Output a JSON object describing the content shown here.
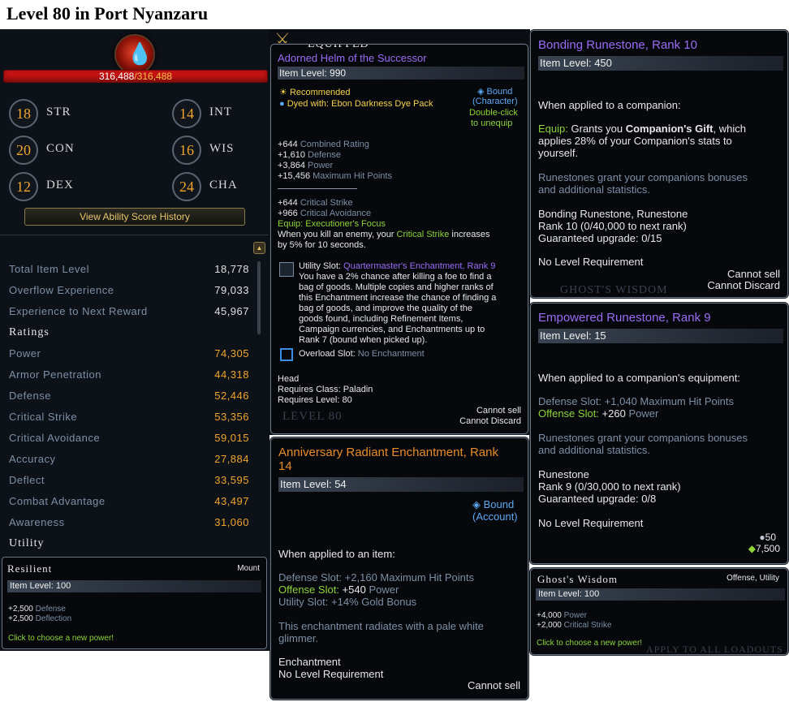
{
  "page_title": "Level 80 in Port Nyanzaru",
  "character": {
    "hp_current": "316,488",
    "hp_sep": "/",
    "hp_max": "316,488",
    "abilities": [
      {
        "score": "18",
        "name": "STR"
      },
      {
        "score": "14",
        "name": "INT"
      },
      {
        "score": "20",
        "name": "CON"
      },
      {
        "score": "16",
        "name": "WIS"
      },
      {
        "score": "12",
        "name": "DEX"
      },
      {
        "score": "24",
        "name": "CHA"
      }
    ],
    "history_button": "View Ability Score History",
    "general": [
      {
        "label": "Total Item Level",
        "value": "18,778"
      },
      {
        "label": "Overflow Experience",
        "value": "79,033"
      },
      {
        "label": "Experience to Next Reward",
        "value": "45,967"
      }
    ],
    "ratings_heading": "Ratings",
    "ratings": [
      {
        "label": "Power",
        "value": "74,305"
      },
      {
        "label": "Armor Penetration",
        "value": "44,318"
      },
      {
        "label": "Defense",
        "value": "52,446"
      },
      {
        "label": "Critical Strike",
        "value": "53,356"
      },
      {
        "label": "Critical Avoidance",
        "value": "59,015"
      },
      {
        "label": "Accuracy",
        "value": "27,884"
      },
      {
        "label": "Deflect",
        "value": "33,595"
      },
      {
        "label": "Combat Advantage",
        "value": "43,497"
      },
      {
        "label": "Awareness",
        "value": "31,060"
      }
    ],
    "utility_heading": "Utility"
  },
  "resilient": {
    "title": "Resilient",
    "type": "Mount",
    "item_level": "Item Level: 100",
    "stat1_value": "+2,500",
    "stat1_name": "Defense",
    "stat2_value": "+2,500",
    "stat2_name": "Deflection",
    "hint": "Click to choose a new power!"
  },
  "helm": {
    "header": "Equipped",
    "name": "Adorned Helm of the Successor",
    "item_level": "Item Level: 990",
    "recommended": "Recommended",
    "dye_label": "Dyed with:",
    "dye_value": "Ebon Darkness Dye Pack",
    "bound": "Bound",
    "bound_type": "(Character)",
    "unequip1": "Double-click",
    "unequip2": "to unequip",
    "stats": [
      {
        "v": "+644",
        "n": "Combined Rating"
      },
      {
        "v": "+1,610",
        "n": "Defense"
      },
      {
        "v": "+3,864",
        "n": "Power"
      },
      {
        "v": "+15,456",
        "n": "Maximum Hit Points"
      }
    ],
    "stats2": [
      {
        "v": "+644",
        "n": "Critical Strike"
      },
      {
        "v": "+966",
        "n": "Critical Avoidance"
      }
    ],
    "equip_label": "Equip:",
    "equip_name": "Executioner's Focus",
    "equip_desc1a": "When you kill an enemy, your ",
    "equip_desc1b": "Critical Strike",
    "equip_desc1c": " increases",
    "equip_desc2": "by 5% for 10 seconds.",
    "utility_label": "Utility Slot:",
    "utility_name": "Quartermaster's Enchantment, Rank 9",
    "utility_desc": [
      "You have a 2% chance after killing a foe to find a",
      "bag of goods. Multiple copies and higher ranks of",
      "this Enchantment increase the chance of finding a",
      "bag of goods, and improve the quality of the",
      "goods found, including Refinement Items,",
      "Campaign currencies, and Enchantments up to",
      "Rank 7 (bound when picked up)."
    ],
    "overload_label": "Overload Slot:",
    "overload_value": "No Enchantment",
    "slot": "Head",
    "req_class": "Requires Class: Paladin",
    "req_level": "Requires Level: 80",
    "cannot_sell": "Cannot sell",
    "cannot_discard": "Cannot Discard",
    "bg_level": "Level 80"
  },
  "anniversary": {
    "name_line1": "Anniversary Radiant Enchantment, Rank",
    "name_line2": "14",
    "item_level": "Item Level: 54",
    "bound": "Bound",
    "bound_type": "(Account)",
    "applied": "When applied to an item:",
    "defense_label": "Defense Slot:",
    "defense_value": "+2,160 Maximum Hit Points",
    "offense_label": "Offense Slot:",
    "offense_value_a": "+540",
    "offense_value_b": "Power",
    "utility_label": "Utility Slot:",
    "utility_value": "+14% Gold Bonus",
    "desc1": "This enchantment radiates with a pale white",
    "desc2": "glimmer.",
    "kind": "Enchantment",
    "level_req": "No Level Requirement",
    "cannot_sell": "Cannot sell"
  },
  "bonding": {
    "name": "Bonding Runestone, Rank 10",
    "item_level": "Item Level: 450",
    "applied": "When applied to a companion:",
    "equip_label": "Equip:",
    "equip_text_a": "Grants you ",
    "equip_text_b": "Companion's Gift",
    "equip_text_c": ", which",
    "equip_line2": "applies 28% of your Companion's stats to",
    "equip_line3": "yourself.",
    "desc1": "Runestones grant your companions bonuses",
    "desc2": "and additional statistics.",
    "rank_title": "Bonding Runestone, Runestone",
    "rank_line": "Rank 10 (0/40,000 to next rank)",
    "upgrade": "Guaranteed upgrade: 0/15",
    "level_req": "No Level Requirement",
    "cannot_sell": "Cannot sell",
    "cannot_discard": "Cannot Discard",
    "bg_text": "Ghost's Wisdom"
  },
  "empowered": {
    "name": "Empowered Runestone, Rank 9",
    "item_level": "Item Level: 15",
    "applied": "When applied to a companion's equipment:",
    "defense_label": "Defense Slot:",
    "defense_value_a": "+1,040",
    "defense_value_b": "Maximum Hit Points",
    "offense_label": "Offense Slot:",
    "offense_value_a": "+260",
    "offense_value_b": "Power",
    "desc1": "Runestones grant your companions bonuses",
    "desc2": "and additional statistics.",
    "kind": "Runestone",
    "rank_line": "Rank 9 (0/30,000 to next rank)",
    "upgrade": "Guaranteed upgrade: 0/8",
    "level_req": "No Level Requirement",
    "price_silver": "50",
    "price_ad": "7,500"
  },
  "ghost": {
    "title": "Ghost's Wisdom",
    "type": "Offense, Utility",
    "item_level": "Item Level: 100",
    "stat1_value": "+4,000",
    "stat1_name": "Power",
    "stat2_value": "+2,000",
    "stat2_name": "Critical Strike",
    "hint": "Click to choose a new power!",
    "bg_text": "Apply To All Loadouts"
  },
  "colors": {
    "purple_name": "#9a6cf5",
    "orange_name": "#e88c2a",
    "green": "#8dd43a",
    "stat_blue": "#7d8fa6",
    "value_orange": "#f0a52c"
  }
}
